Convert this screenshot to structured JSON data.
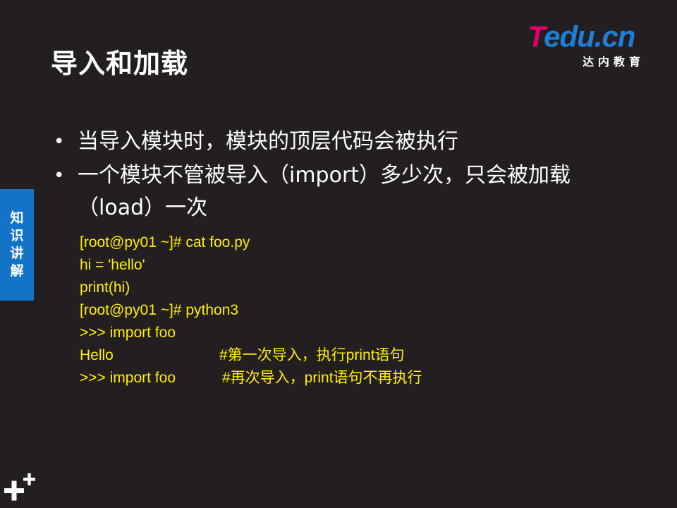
{
  "slide": {
    "title": "导入和加载",
    "logo": {
      "brand_t": "T",
      "brand_rest": "edu.cn",
      "subtitle": "达内教育"
    },
    "side_tab": {
      "label": "知识讲解"
    },
    "bullets": [
      "当导入模块时，模块的顶层代码会被执行",
      "一个模块不管被导入（import）多少次，只会被加载（load）一次"
    ],
    "code_lines": [
      {
        "text": "[root@py01 ~]# cat foo.py",
        "comment": ""
      },
      {
        "text": "hi = 'hello'",
        "comment": ""
      },
      {
        "text": "print(hi)",
        "comment": ""
      },
      {
        "text": "[root@py01 ~]# python3",
        "comment": ""
      },
      {
        "text": ">>> import foo",
        "comment": ""
      },
      {
        "text": "Hello",
        "comment": "#第一次导入，执行print语句"
      },
      {
        "text": ">>> import foo",
        "comment": "#再次导入，print语句不再执行"
      }
    ],
    "colors": {
      "background": "#231f20",
      "code": "#ffef00",
      "side_tab": "#1273c7",
      "logo_pink": "#e2006a",
      "logo_blue": "#1e7fd6"
    },
    "icons": {
      "corner": "plus-plus-icon"
    }
  }
}
